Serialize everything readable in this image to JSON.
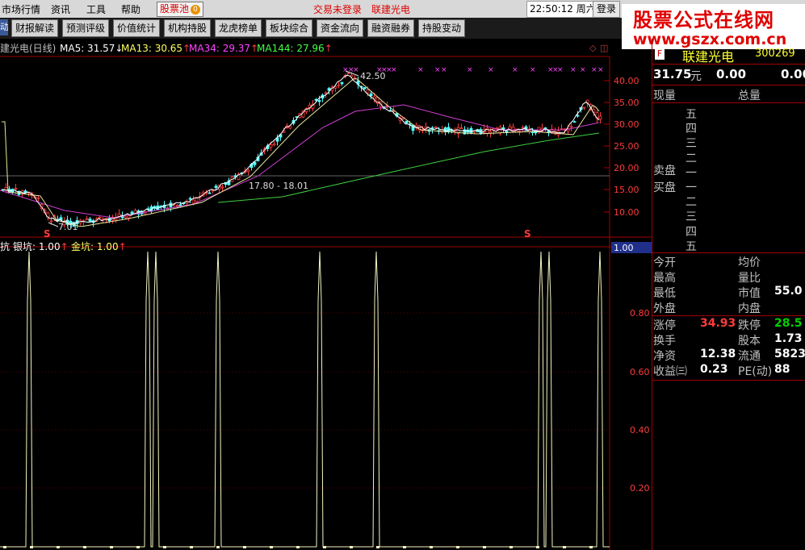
{
  "menu": {
    "items": [
      "市场行情",
      "资讯",
      "工具",
      "帮助"
    ],
    "pool_label": "股票池",
    "pool_badge": "0",
    "login_status": "交易未登录",
    "stock_name": "联建光电",
    "time": "22:50:12",
    "weekday": "周六",
    "button": "登录"
  },
  "toolbar": {
    "edge": "动",
    "buttons": [
      "财报解读",
      "预测评级",
      "价值统计",
      "机构持股",
      "龙虎榜单",
      "板块综合",
      "资金流向",
      "融资融券",
      "持股变动"
    ]
  },
  "brand": {
    "title": "股票公式在线网",
    "url": "www.gszx.com.cn"
  },
  "main_chart": {
    "title": "建光电(日线)",
    "ma_items": [
      {
        "label": "MA5: 31.57",
        "arrow": "↓",
        "color": "#ffffff"
      },
      {
        "label": "MA13: 30.65",
        "arrow": "↑",
        "color": "#ffff66"
      },
      {
        "label": "MA34: 29.37",
        "arrow": "↑",
        "color": "#ff44ff"
      },
      {
        "label": "MA144: 27.96",
        "arrow": "↑",
        "color": "#44ff44"
      }
    ],
    "price_labels": [
      "40.00",
      "35.00",
      "30.00",
      "25.00",
      "20.00",
      "15.00",
      "10.00"
    ],
    "high_label": "42.50",
    "range_label": "17.80 - 18.01",
    "low_label": "7.01",
    "marker": "S",
    "corner_icons": [
      "◇",
      "◫"
    ]
  },
  "sub_chart": {
    "labels": [
      {
        "label": "抗",
        "color": "#ffffff"
      },
      {
        "label": "银坑: 1.00",
        "arrow": "↑",
        "color": "#ffffff"
      },
      {
        "label": "金坑: 1.00",
        "arrow": "↑",
        "color": "#ffff66"
      }
    ],
    "current_value": "1.00",
    "y_labels": [
      "0.80",
      "0.60",
      "0.40",
      "0.20"
    ]
  },
  "quote": {
    "badge": "F",
    "name": "联建光电",
    "code": "300269",
    "price": "31.75",
    "unit": "元",
    "change": "0.00",
    "change_pct": "0.00",
    "col1": "现量",
    "col2": "总量",
    "sell_label": "卖盘",
    "buy_label": "买盘",
    "levels": [
      "五",
      "四",
      "三",
      "二",
      "一",
      "一",
      "二",
      "三",
      "四",
      "五"
    ],
    "fields": [
      {
        "l": "今开",
        "r": "均价"
      },
      {
        "l": "最高",
        "r": "量比"
      },
      {
        "l": "最低",
        "r": "市值",
        "rv": "55.0"
      },
      {
        "l": "外盘",
        "r": "内盘"
      }
    ],
    "fields2": [
      {
        "l": "涨停",
        "lv": "34.93",
        "r": "跌停",
        "rv": "28.5"
      },
      {
        "l": "换手",
        "lv": "",
        "r": "股本",
        "rv": "1.73"
      },
      {
        "l": "净资",
        "lv": "12.38",
        "r": "流通",
        "rv": "5823"
      },
      {
        "l": "收益㈢",
        "lv": "0.23",
        "r": "PE(动)",
        "rv": "88"
      }
    ]
  }
}
